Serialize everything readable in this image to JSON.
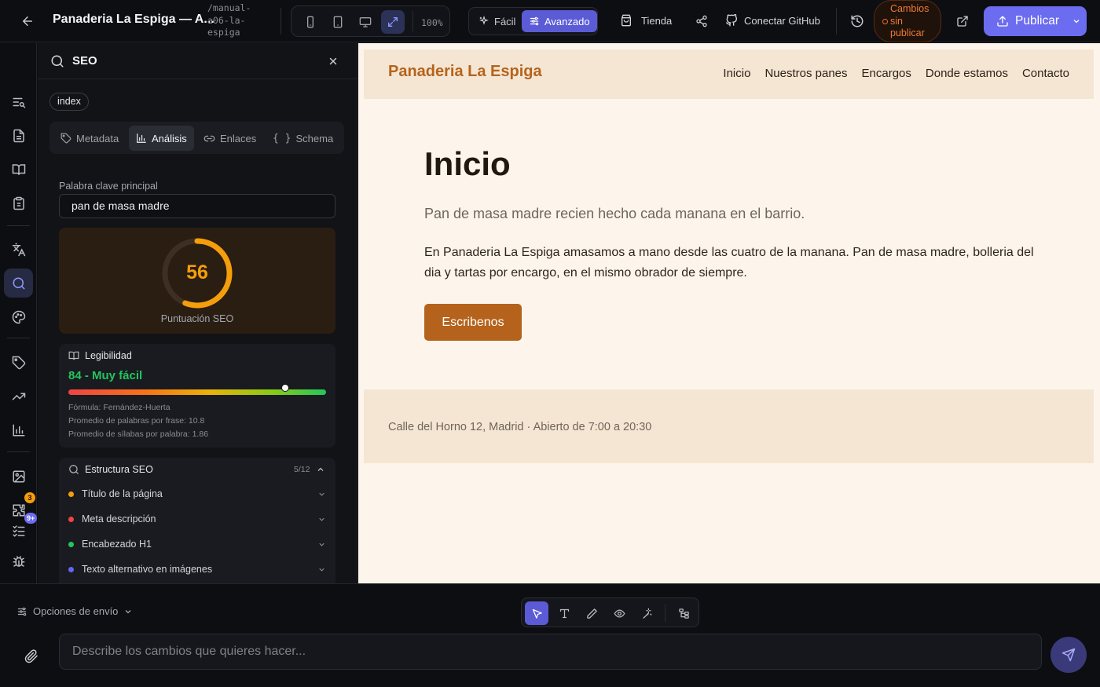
{
  "app": {
    "project_title": "Panaderia La Espiga — A...",
    "slug": "/manual-a06-la-espiga",
    "zoom": "100%",
    "mode_easy": "Fácil",
    "mode_advanced": "Avanzado",
    "store": "Tienda",
    "connect_github": "Conectar GitHub",
    "unpublished": "Cambios sin publicar",
    "publish": "Publicar"
  },
  "rail": {
    "badge_puzzle": "3",
    "badge_tasks": "9+"
  },
  "seo_panel": {
    "search_value": "SEO",
    "page_chip": "index",
    "tabs": [
      "Metadata",
      "Análisis",
      "Enlaces",
      "Schema"
    ],
    "active_tab": "Análisis",
    "keyword_label": "Palabra clave principal",
    "keyword_value": "pan de masa madre",
    "score": "56",
    "score_fraction": 0.56,
    "score_label": "Puntuación SEO",
    "readability_title": "Legibilidad",
    "readability_value": "84 - Muy fácil",
    "readability_fraction": 0.84,
    "formula": "Fórmula: Fernández-Huerta",
    "avg_words": "Promedio de palabras por frase: 10.8",
    "avg_syllables": "Promedio de sílabas por palabra: 1.86",
    "structure_title": "Estructura SEO",
    "structure_count": "5/12",
    "checks": [
      {
        "label": "Título de la página",
        "color": "#f59e0b"
      },
      {
        "label": "Meta descripción",
        "color": "#ef4444"
      },
      {
        "label": "Encabezado H1",
        "color": "#22c55e"
      },
      {
        "label": "Texto alternativo en imágenes",
        "color": "#6366f1"
      }
    ]
  },
  "preview": {
    "logo": "Panaderia La Espiga",
    "nav": [
      "Inicio",
      "Nuestros panes",
      "Encargos",
      "Donde estamos",
      "Contacto"
    ],
    "h1": "Inicio",
    "subtitle": "Pan de masa madre recien hecho cada manana en el barrio.",
    "body": "En Panaderia La Espiga amasamos a mano desde las cuatro de la manana. Pan de masa madre, bolleria del dia y tartas por encargo, en el mismo obrador de siempre.",
    "cta": "Escribenos",
    "footer": "Calle del Horno 12, Madrid · Abierto de 7:00 a 20:30"
  },
  "composer": {
    "send_options": "Opciones de envío",
    "placeholder": "Describe los cambios que quieres hacer..."
  },
  "colors": {
    "accent": "#6c6cf0",
    "brand": "#b5631c",
    "score_ring": "#f59e0b",
    "readability_text": "#22c55e",
    "unpublished": "#ee7a35"
  }
}
